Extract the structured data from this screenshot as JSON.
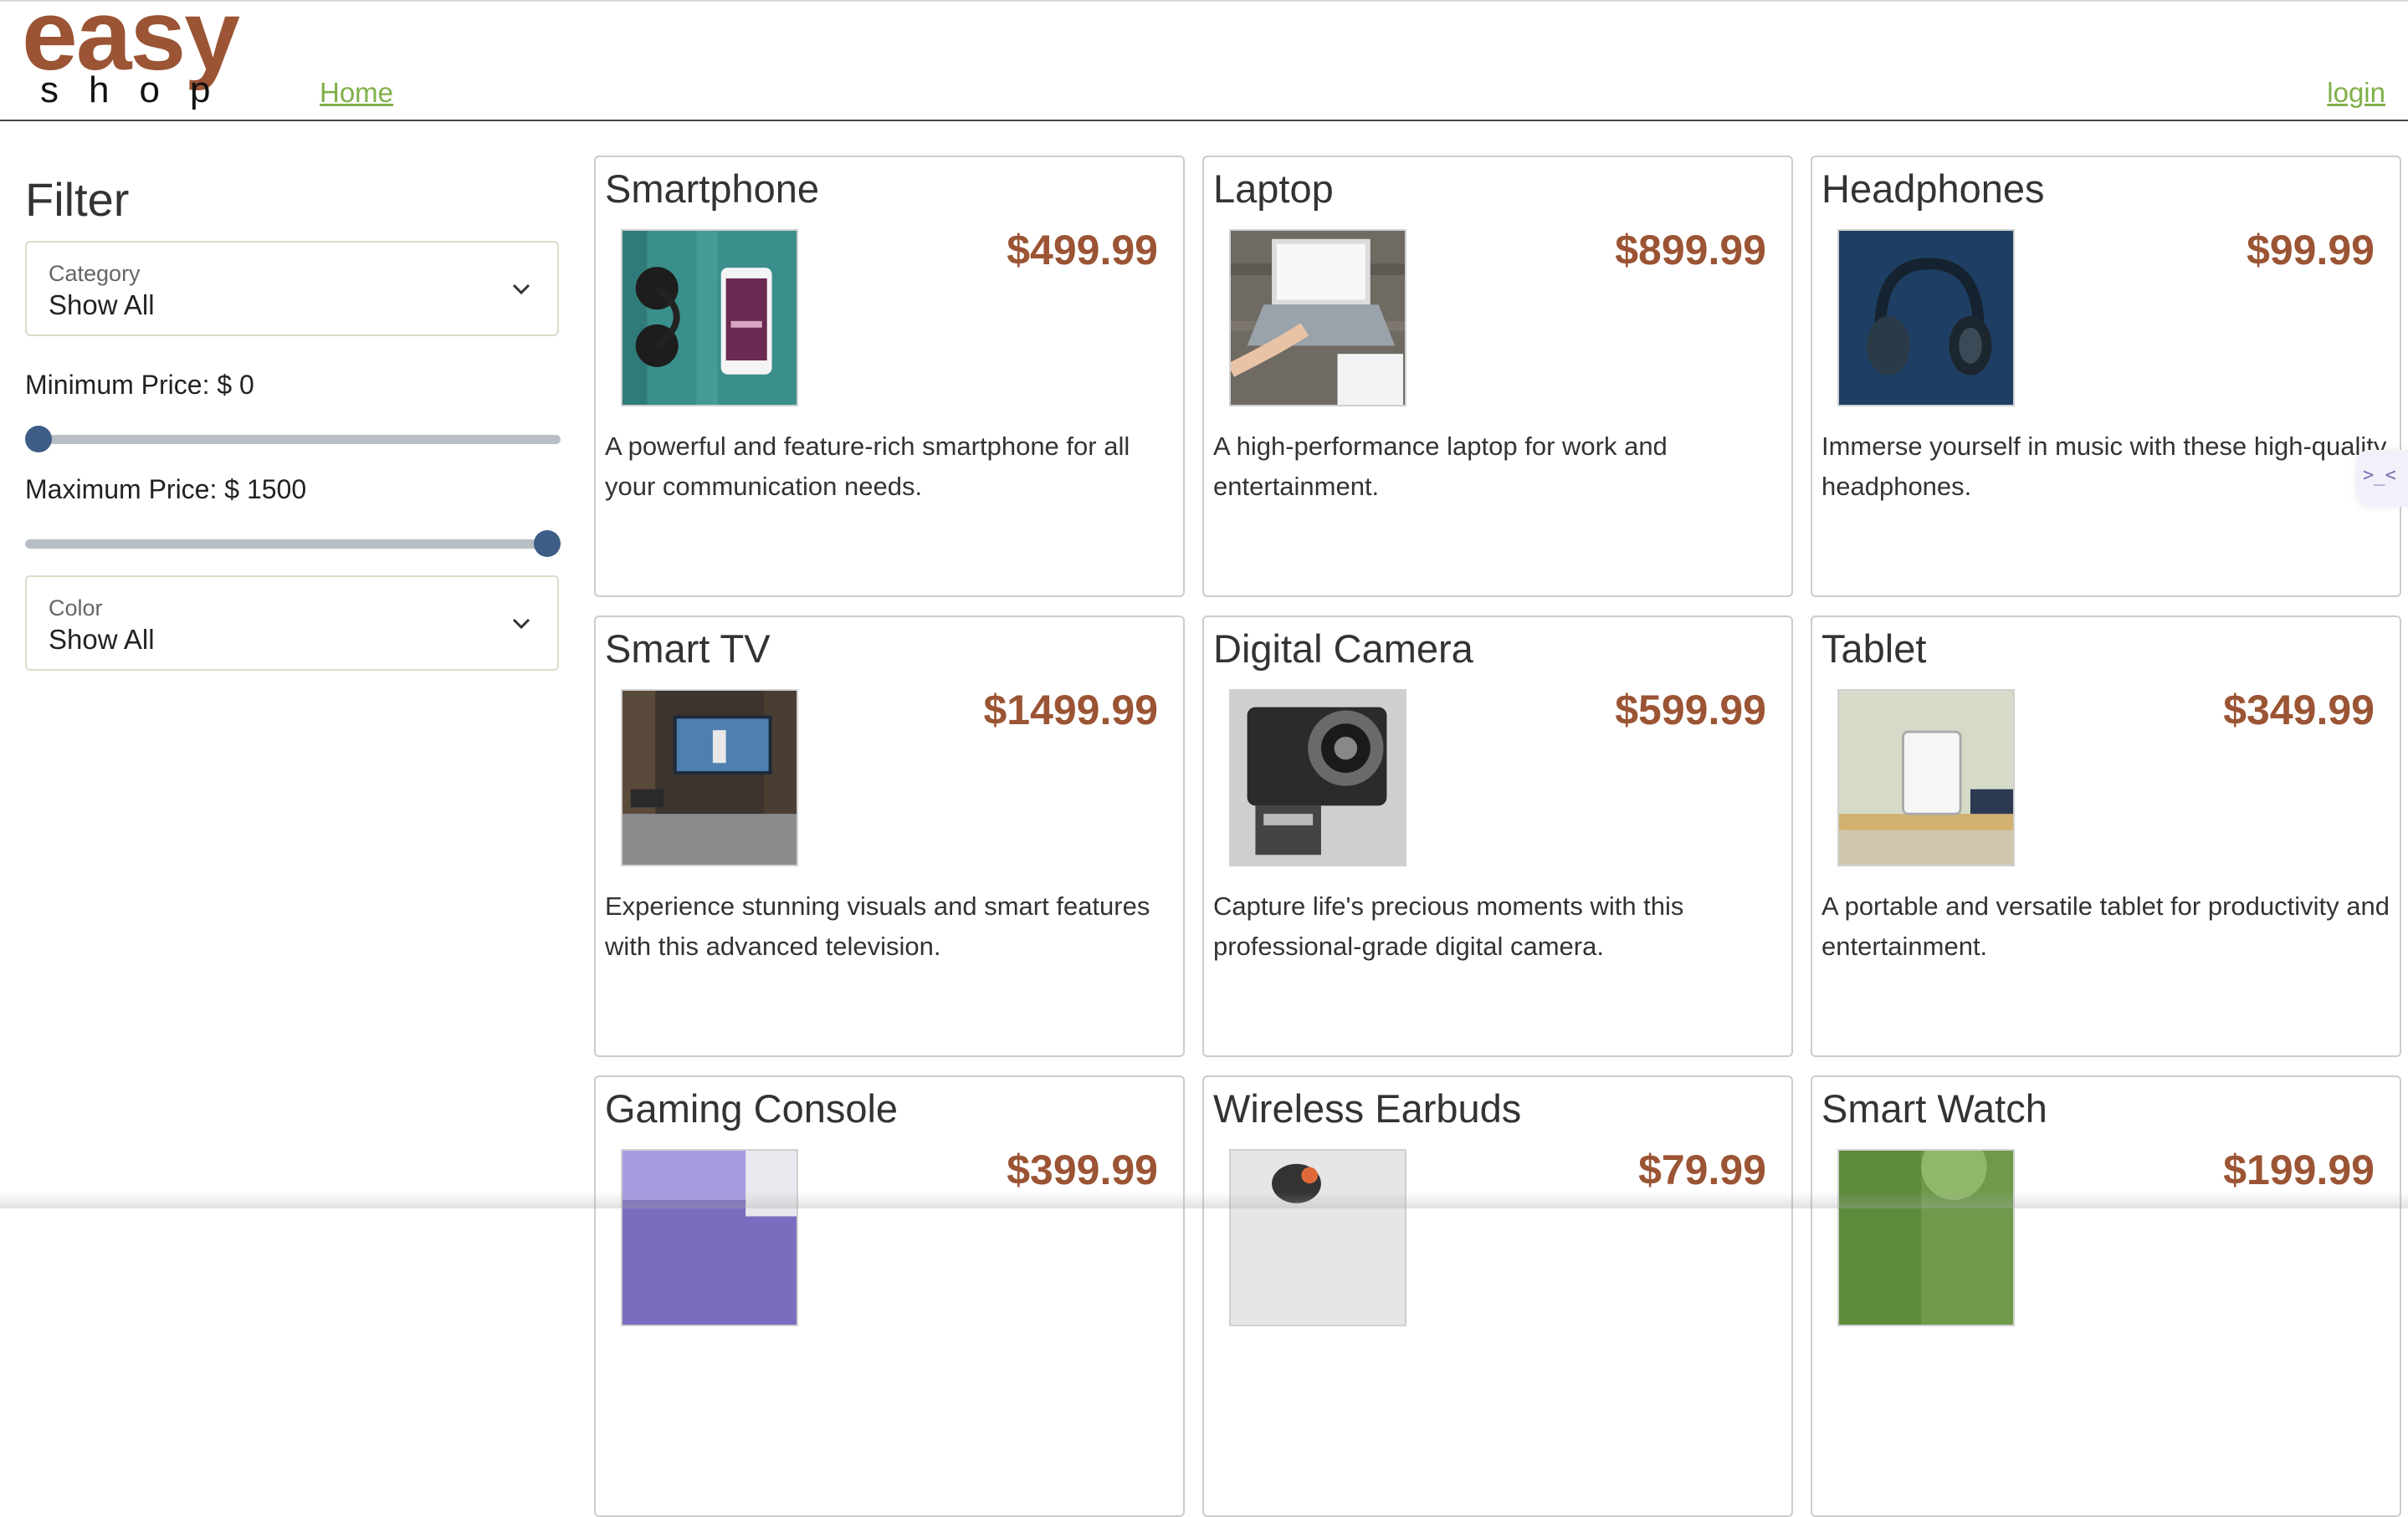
{
  "brand": {
    "logo_top": "easy",
    "logo_bottom": "shop"
  },
  "nav": {
    "home": "Home",
    "login": "login"
  },
  "filter": {
    "title": "Filter",
    "category": {
      "label": "Category",
      "value": "Show All"
    },
    "min_price": {
      "label": "Minimum Price: $ 0",
      "value": 0
    },
    "max_price": {
      "label": "Maximum Price: $ 1500",
      "value": 1500
    },
    "color": {
      "label": "Color",
      "value": "Show All"
    },
    "slider_range": [
      0,
      1500
    ]
  },
  "products": [
    {
      "name": "Smartphone",
      "price": "$499.99",
      "description": "A powerful and feature-rich smartphone for all your communication needs.",
      "image_icon": "smartphone-headphones-photo"
    },
    {
      "name": "Laptop",
      "price": "$899.99",
      "description": "A high-performance laptop for work and entertainment.",
      "image_icon": "laptop-photo"
    },
    {
      "name": "Headphones",
      "price": "$99.99",
      "description": "Immerse yourself in music with these high-quality headphones.",
      "image_icon": "headphones-photo"
    },
    {
      "name": "Smart TV",
      "price": "$1499.99",
      "description": "Experience stunning visuals and smart features with this advanced television.",
      "image_icon": "smart-tv-photo"
    },
    {
      "name": "Digital Camera",
      "price": "$599.99",
      "description": "Capture life's precious moments with this professional-grade digital camera.",
      "image_icon": "camera-photo"
    },
    {
      "name": "Tablet",
      "price": "$349.99",
      "description": "A portable and versatile tablet for productivity and entertainment.",
      "image_icon": "tablet-photo"
    },
    {
      "name": "Gaming Console",
      "price": "$399.99",
      "description": "",
      "image_icon": "gaming-console-photo"
    },
    {
      "name": "Wireless Earbuds",
      "price": "$79.99",
      "description": "",
      "image_icon": "earbuds-photo"
    },
    {
      "name": "Smart Watch",
      "price": "$199.99",
      "description": "",
      "image_icon": "smart-watch-photo"
    }
  ],
  "colors": {
    "brand": "#9b5434",
    "link": "#7fb048",
    "slider_thumb": "#3d5c86"
  },
  "widget": {
    "icon": "assistant-icon",
    "glyph": ">_<"
  }
}
